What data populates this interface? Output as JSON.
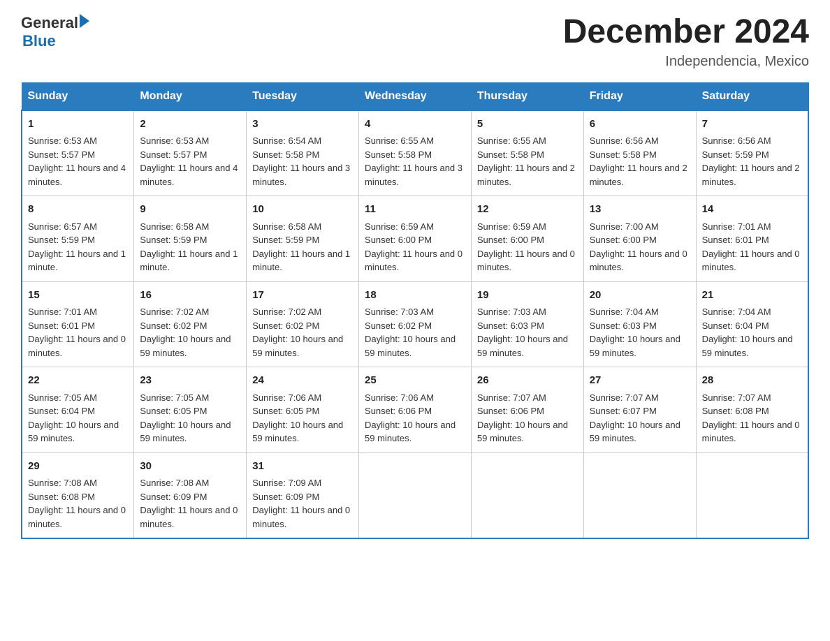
{
  "header": {
    "logo_general": "General",
    "logo_blue": "Blue",
    "month_title": "December 2024",
    "location": "Independencia, Mexico"
  },
  "days_of_week": [
    "Sunday",
    "Monday",
    "Tuesday",
    "Wednesday",
    "Thursday",
    "Friday",
    "Saturday"
  ],
  "weeks": [
    [
      {
        "day": "1",
        "sunrise": "6:53 AM",
        "sunset": "5:57 PM",
        "daylight": "11 hours and 4 minutes."
      },
      {
        "day": "2",
        "sunrise": "6:53 AM",
        "sunset": "5:57 PM",
        "daylight": "11 hours and 4 minutes."
      },
      {
        "day": "3",
        "sunrise": "6:54 AM",
        "sunset": "5:58 PM",
        "daylight": "11 hours and 3 minutes."
      },
      {
        "day": "4",
        "sunrise": "6:55 AM",
        "sunset": "5:58 PM",
        "daylight": "11 hours and 3 minutes."
      },
      {
        "day": "5",
        "sunrise": "6:55 AM",
        "sunset": "5:58 PM",
        "daylight": "11 hours and 2 minutes."
      },
      {
        "day": "6",
        "sunrise": "6:56 AM",
        "sunset": "5:58 PM",
        "daylight": "11 hours and 2 minutes."
      },
      {
        "day": "7",
        "sunrise": "6:56 AM",
        "sunset": "5:59 PM",
        "daylight": "11 hours and 2 minutes."
      }
    ],
    [
      {
        "day": "8",
        "sunrise": "6:57 AM",
        "sunset": "5:59 PM",
        "daylight": "11 hours and 1 minute."
      },
      {
        "day": "9",
        "sunrise": "6:58 AM",
        "sunset": "5:59 PM",
        "daylight": "11 hours and 1 minute."
      },
      {
        "day": "10",
        "sunrise": "6:58 AM",
        "sunset": "5:59 PM",
        "daylight": "11 hours and 1 minute."
      },
      {
        "day": "11",
        "sunrise": "6:59 AM",
        "sunset": "6:00 PM",
        "daylight": "11 hours and 0 minutes."
      },
      {
        "day": "12",
        "sunrise": "6:59 AM",
        "sunset": "6:00 PM",
        "daylight": "11 hours and 0 minutes."
      },
      {
        "day": "13",
        "sunrise": "7:00 AM",
        "sunset": "6:00 PM",
        "daylight": "11 hours and 0 minutes."
      },
      {
        "day": "14",
        "sunrise": "7:01 AM",
        "sunset": "6:01 PM",
        "daylight": "11 hours and 0 minutes."
      }
    ],
    [
      {
        "day": "15",
        "sunrise": "7:01 AM",
        "sunset": "6:01 PM",
        "daylight": "11 hours and 0 minutes."
      },
      {
        "day": "16",
        "sunrise": "7:02 AM",
        "sunset": "6:02 PM",
        "daylight": "10 hours and 59 minutes."
      },
      {
        "day": "17",
        "sunrise": "7:02 AM",
        "sunset": "6:02 PM",
        "daylight": "10 hours and 59 minutes."
      },
      {
        "day": "18",
        "sunrise": "7:03 AM",
        "sunset": "6:02 PM",
        "daylight": "10 hours and 59 minutes."
      },
      {
        "day": "19",
        "sunrise": "7:03 AM",
        "sunset": "6:03 PM",
        "daylight": "10 hours and 59 minutes."
      },
      {
        "day": "20",
        "sunrise": "7:04 AM",
        "sunset": "6:03 PM",
        "daylight": "10 hours and 59 minutes."
      },
      {
        "day": "21",
        "sunrise": "7:04 AM",
        "sunset": "6:04 PM",
        "daylight": "10 hours and 59 minutes."
      }
    ],
    [
      {
        "day": "22",
        "sunrise": "7:05 AM",
        "sunset": "6:04 PM",
        "daylight": "10 hours and 59 minutes."
      },
      {
        "day": "23",
        "sunrise": "7:05 AM",
        "sunset": "6:05 PM",
        "daylight": "10 hours and 59 minutes."
      },
      {
        "day": "24",
        "sunrise": "7:06 AM",
        "sunset": "6:05 PM",
        "daylight": "10 hours and 59 minutes."
      },
      {
        "day": "25",
        "sunrise": "7:06 AM",
        "sunset": "6:06 PM",
        "daylight": "10 hours and 59 minutes."
      },
      {
        "day": "26",
        "sunrise": "7:07 AM",
        "sunset": "6:06 PM",
        "daylight": "10 hours and 59 minutes."
      },
      {
        "day": "27",
        "sunrise": "7:07 AM",
        "sunset": "6:07 PM",
        "daylight": "10 hours and 59 minutes."
      },
      {
        "day": "28",
        "sunrise": "7:07 AM",
        "sunset": "6:08 PM",
        "daylight": "11 hours and 0 minutes."
      }
    ],
    [
      {
        "day": "29",
        "sunrise": "7:08 AM",
        "sunset": "6:08 PM",
        "daylight": "11 hours and 0 minutes."
      },
      {
        "day": "30",
        "sunrise": "7:08 AM",
        "sunset": "6:09 PM",
        "daylight": "11 hours and 0 minutes."
      },
      {
        "day": "31",
        "sunrise": "7:09 AM",
        "sunset": "6:09 PM",
        "daylight": "11 hours and 0 minutes."
      },
      null,
      null,
      null,
      null
    ]
  ],
  "labels": {
    "sunrise": "Sunrise: ",
    "sunset": "Sunset: ",
    "daylight": "Daylight: "
  }
}
